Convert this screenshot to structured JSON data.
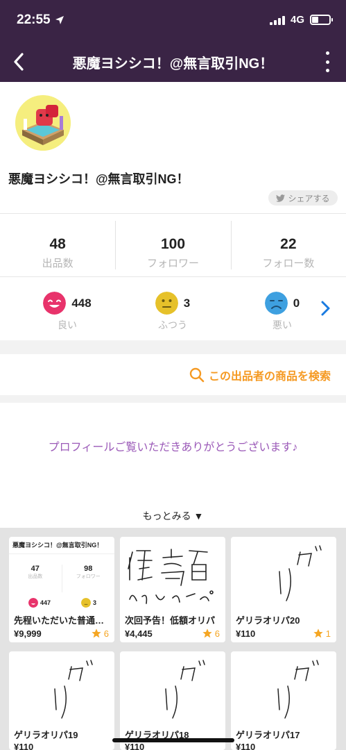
{
  "status_bar": {
    "time": "22:55",
    "network": "4G"
  },
  "nav": {
    "title": "悪魔ヨシシコ！@無言取引NG！"
  },
  "profile": {
    "username": "悪魔ヨシシコ！@無言取引NG！",
    "share_label": "シェアする"
  },
  "stats": [
    {
      "value": "48",
      "label": "出品数"
    },
    {
      "value": "100",
      "label": "フォロワー"
    },
    {
      "value": "22",
      "label": "フォロー数"
    }
  ],
  "ratings": [
    {
      "count": "448",
      "label": "良い",
      "color": "#e8336b"
    },
    {
      "count": "3",
      "label": "ふつう",
      "color": "#e6c12a"
    },
    {
      "count": "0",
      "label": "悪い",
      "color": "#3ea0e0"
    }
  ],
  "search_link": "この出品者の商品を検索",
  "bio": "プロフィールご覧いただきありがとうございます♪",
  "more_label": "もっとみる ▼",
  "items": [
    {
      "name": "先程いただいた普通評…",
      "price": "¥9,999",
      "likes": "6",
      "thumb": {
        "title": "悪魔ヨシシコ！@無言取引NG！",
        "stat1": "47",
        "stat1_label": "出品数",
        "stat2": "98",
        "stat2_label": "フォロワー",
        "good": "447",
        "normal": "3"
      }
    },
    {
      "name": "次回予告！低額オリパ",
      "price": "¥4,445",
      "likes": "6"
    },
    {
      "name": "ゲリラオリパ20",
      "price": "¥110",
      "likes": "1"
    },
    {
      "name": "ゲリラオリパ19",
      "price": "¥110"
    },
    {
      "name": "ゲリラオリパ18",
      "price": "¥110"
    },
    {
      "name": "ゲリラオリパ17",
      "price": "¥110"
    }
  ],
  "colors": {
    "header_bg": "#3a2445",
    "accent_orange": "#f59a23",
    "bio_purple": "#9b5ab8",
    "link_blue": "#1a7be0"
  }
}
